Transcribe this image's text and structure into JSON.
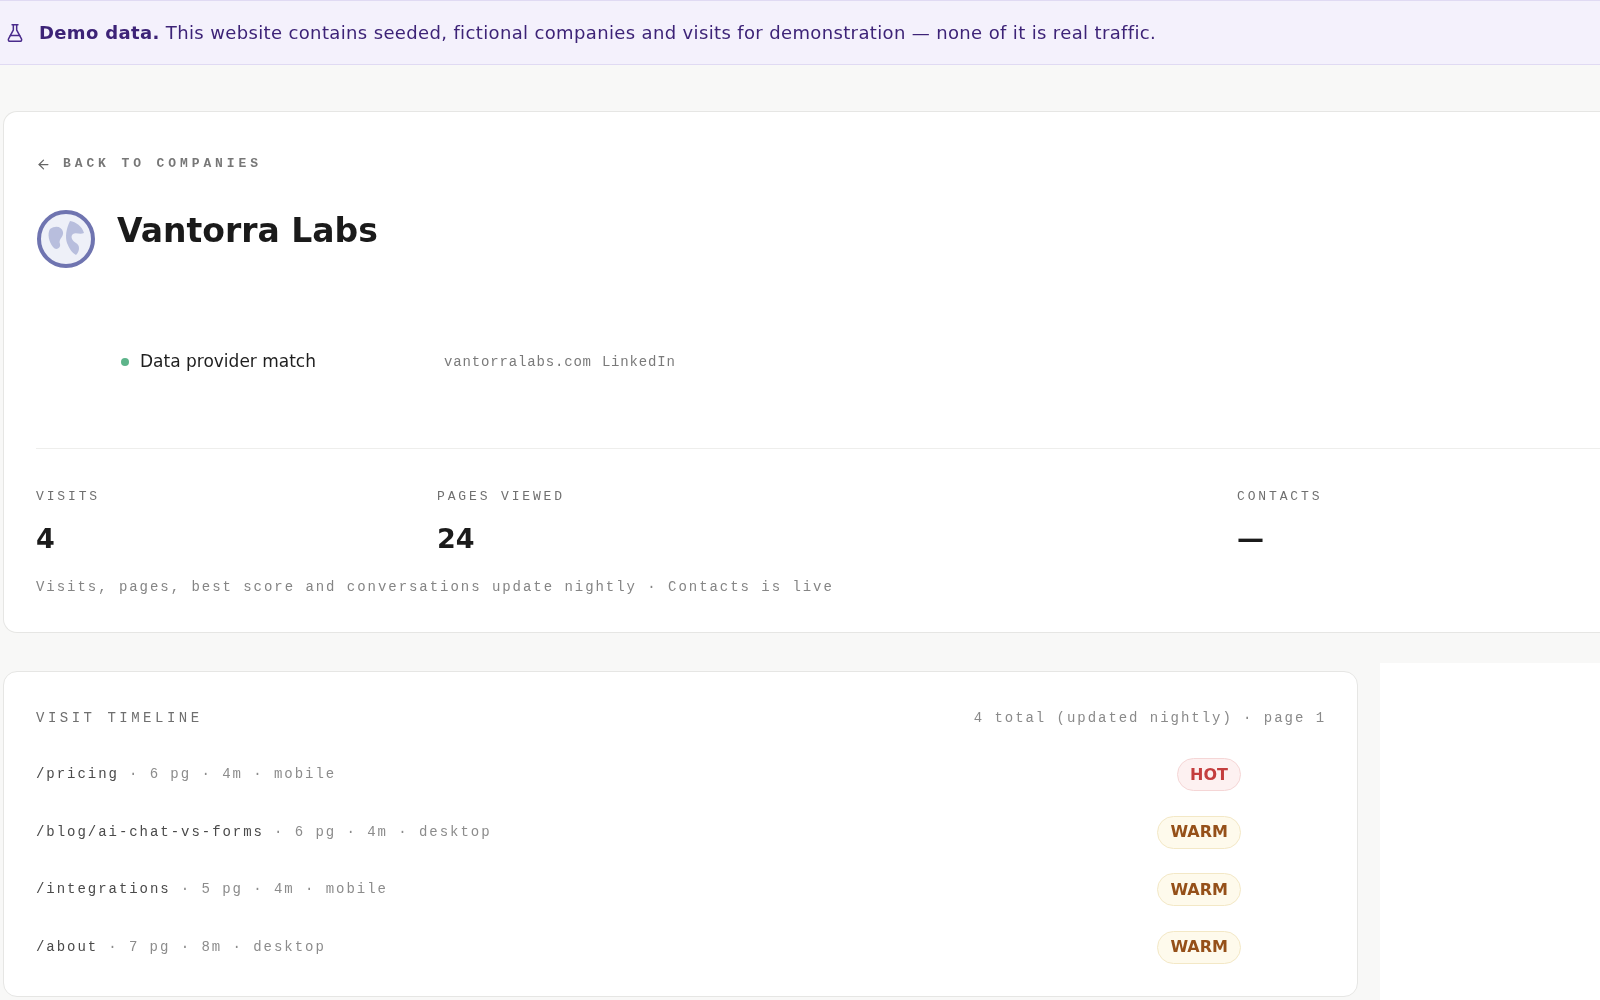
{
  "banner": {
    "text": "**Demo data.** This website contains seeded, fictional companies and visits for demonstration — none of it is real traffic."
  },
  "back_link": "BACK TO COMPANIES",
  "company": {
    "name": "Vantorra Labs",
    "match": "Data provider match",
    "links": [
      "vantorralabs.com",
      "LinkedIn"
    ]
  },
  "stats": [
    {
      "label": "VISITS",
      "value": "4"
    },
    {
      "label": "PAGES VIEWED",
      "value": "24"
    },
    {
      "label": "CONTACTS",
      "value": "—"
    }
  ],
  "stats_note": "Visits, pages, best score and conversations update nightly · Contacts is live",
  "timeline": {
    "title": "VISIT TIMELINE",
    "summary": "4 total (updated nightly) · page 1",
    "visits": [
      {
        "path": "/pricing",
        "details": "· 6 pg · 4m · mobile",
        "badge": {
          "label": "HOT",
          "kind": "hot"
        }
      },
      {
        "path": "/blog/ai-chat-vs-forms",
        "details": "· 6 pg · 4m · desktop",
        "badge": {
          "label": "WARM",
          "kind": "warm"
        }
      },
      {
        "path": "/integrations",
        "details": "· 5 pg · 4m · mobile",
        "badge": {
          "label": "WARM",
          "kind": "warm"
        }
      },
      {
        "path": "/about",
        "details": "· 7 pg · 8m · desktop",
        "badge": {
          "label": "WARM",
          "kind": "warm"
        }
      }
    ]
  }
}
